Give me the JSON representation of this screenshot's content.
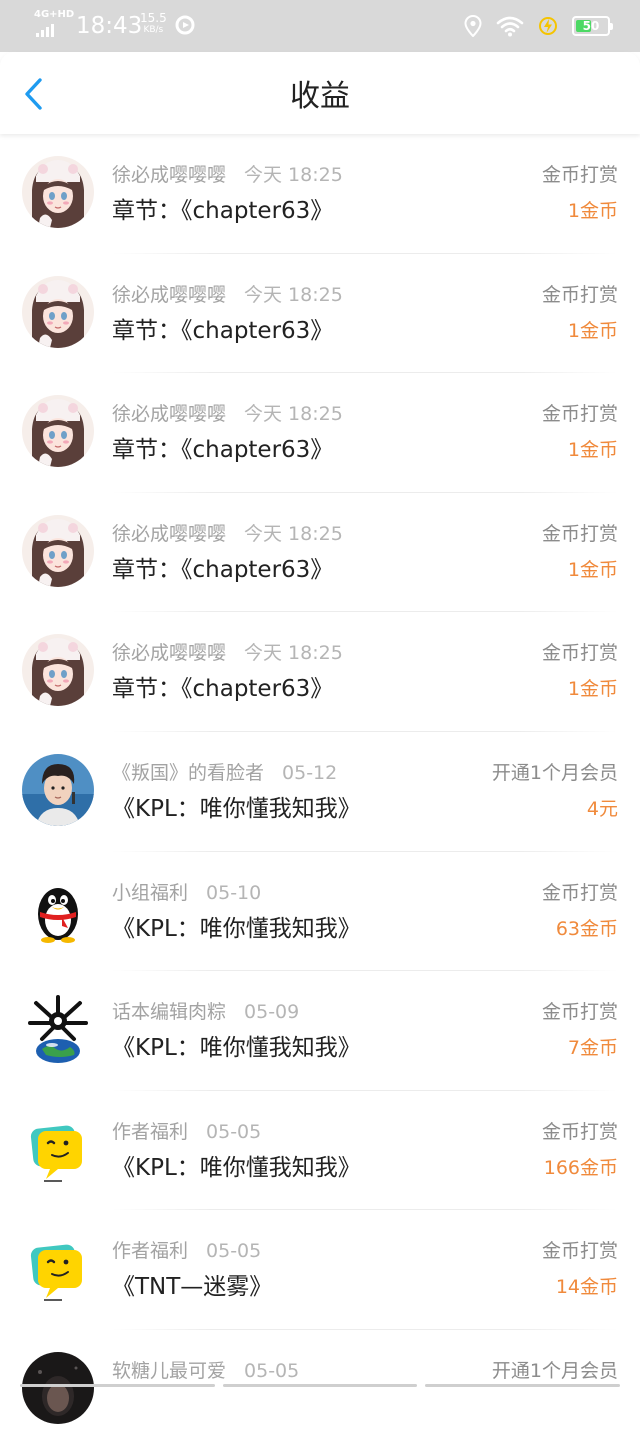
{
  "status_bar": {
    "network": "4G+HD",
    "time": "18:43",
    "speed_value": "15.5",
    "speed_unit": "KB/s",
    "battery": "50",
    "battery_level_percent": 50,
    "battery_color": "#4cd964"
  },
  "header": {
    "title": "收益",
    "back_icon": "chevron-left-icon",
    "accent_color": "#1e9bf0"
  },
  "colors": {
    "amount": "#f08a3c",
    "name": "#a3a3a3",
    "title": "#222222"
  },
  "records": [
    {
      "user": "徐必成嘤嘤嘤",
      "time": "今天 18:25",
      "item": "章节：《chapter63》",
      "type": "金币打赏",
      "amount": "1金币",
      "avatar": "anime-girl-avatar"
    },
    {
      "user": "徐必成嘤嘤嘤",
      "time": "今天 18:25",
      "item": "章节：《chapter63》",
      "type": "金币打赏",
      "amount": "1金币",
      "avatar": "anime-girl-avatar"
    },
    {
      "user": "徐必成嘤嘤嘤",
      "time": "今天 18:25",
      "item": "章节：《chapter63》",
      "type": "金币打赏",
      "amount": "1金币",
      "avatar": "anime-girl-avatar"
    },
    {
      "user": "徐必成嘤嘤嘤",
      "time": "今天 18:25",
      "item": "章节：《chapter63》",
      "type": "金币打赏",
      "amount": "1金币",
      "avatar": "anime-girl-avatar"
    },
    {
      "user": "徐必成嘤嘤嘤",
      "time": "今天 18:25",
      "item": "章节：《chapter63》",
      "type": "金币打赏",
      "amount": "1金币",
      "avatar": "anime-girl-avatar"
    },
    {
      "user": "《叛国》的看脸者",
      "time": "05-12",
      "item": "《KPL：唯你懂我知我》",
      "type": "开通1个月会员",
      "amount": "4元",
      "avatar": "photo-boy-avatar"
    },
    {
      "user": "小组福利",
      "time": "05-10",
      "item": "《KPL：唯你懂我知我》",
      "type": "金币打赏",
      "amount": "63金币",
      "avatar": "penguin-avatar"
    },
    {
      "user": "话本编辑肉粽",
      "time": "05-09",
      "item": "《KPL：唯你懂我知我》",
      "type": "金币打赏",
      "amount": "7金币",
      "avatar": "planet-avatar"
    },
    {
      "user": "作者福利",
      "time": "05-05",
      "item": "《KPL：唯你懂我知我》",
      "type": "金币打赏",
      "amount": "166金币",
      "avatar": "chat-bubble-avatar"
    },
    {
      "user": "作者福利",
      "time": "05-05",
      "item": "《TNT—迷雾》",
      "type": "金币打赏",
      "amount": "14金币",
      "avatar": "chat-bubble-avatar"
    },
    {
      "user": "软糖儿最可爱",
      "time": "05-05",
      "item": "",
      "type": "开通1个月会员",
      "amount": "",
      "avatar": "dark-photo-avatar"
    }
  ]
}
